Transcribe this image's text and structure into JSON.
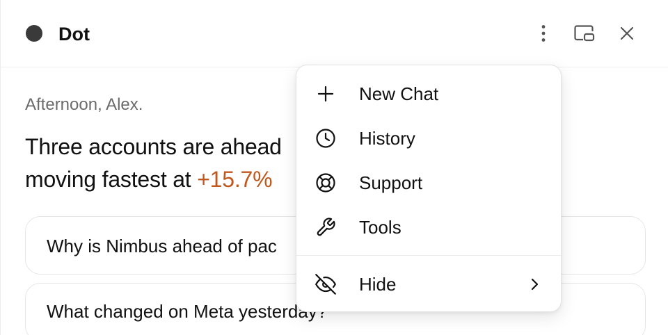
{
  "app": {
    "title": "Dot"
  },
  "header": {
    "more_icon": "vertical-ellipsis-icon",
    "window_icon": "picture-in-picture-icon",
    "close_icon": "close-icon"
  },
  "main": {
    "greeting": "Afternoon, Alex.",
    "summary_line1": "Three accounts are ahead",
    "summary_line2_prefix": "moving fastest at ",
    "summary_highlight": "+15.7%",
    "accent_color": "#c0571d",
    "suggestions": [
      {
        "text": "Why is Nimbus ahead of pac"
      },
      {
        "text": "What changed on Meta yesterday?"
      }
    ]
  },
  "menu": {
    "items": [
      {
        "label": "New Chat",
        "icon": "plus-icon"
      },
      {
        "label": "History",
        "icon": "clock-icon"
      },
      {
        "label": "Support",
        "icon": "lifebuoy-icon"
      },
      {
        "label": "Tools",
        "icon": "wrench-icon"
      },
      {
        "label": "Hide",
        "icon": "eye-off-icon",
        "submenu_icon": "chevron-right-icon"
      }
    ]
  }
}
